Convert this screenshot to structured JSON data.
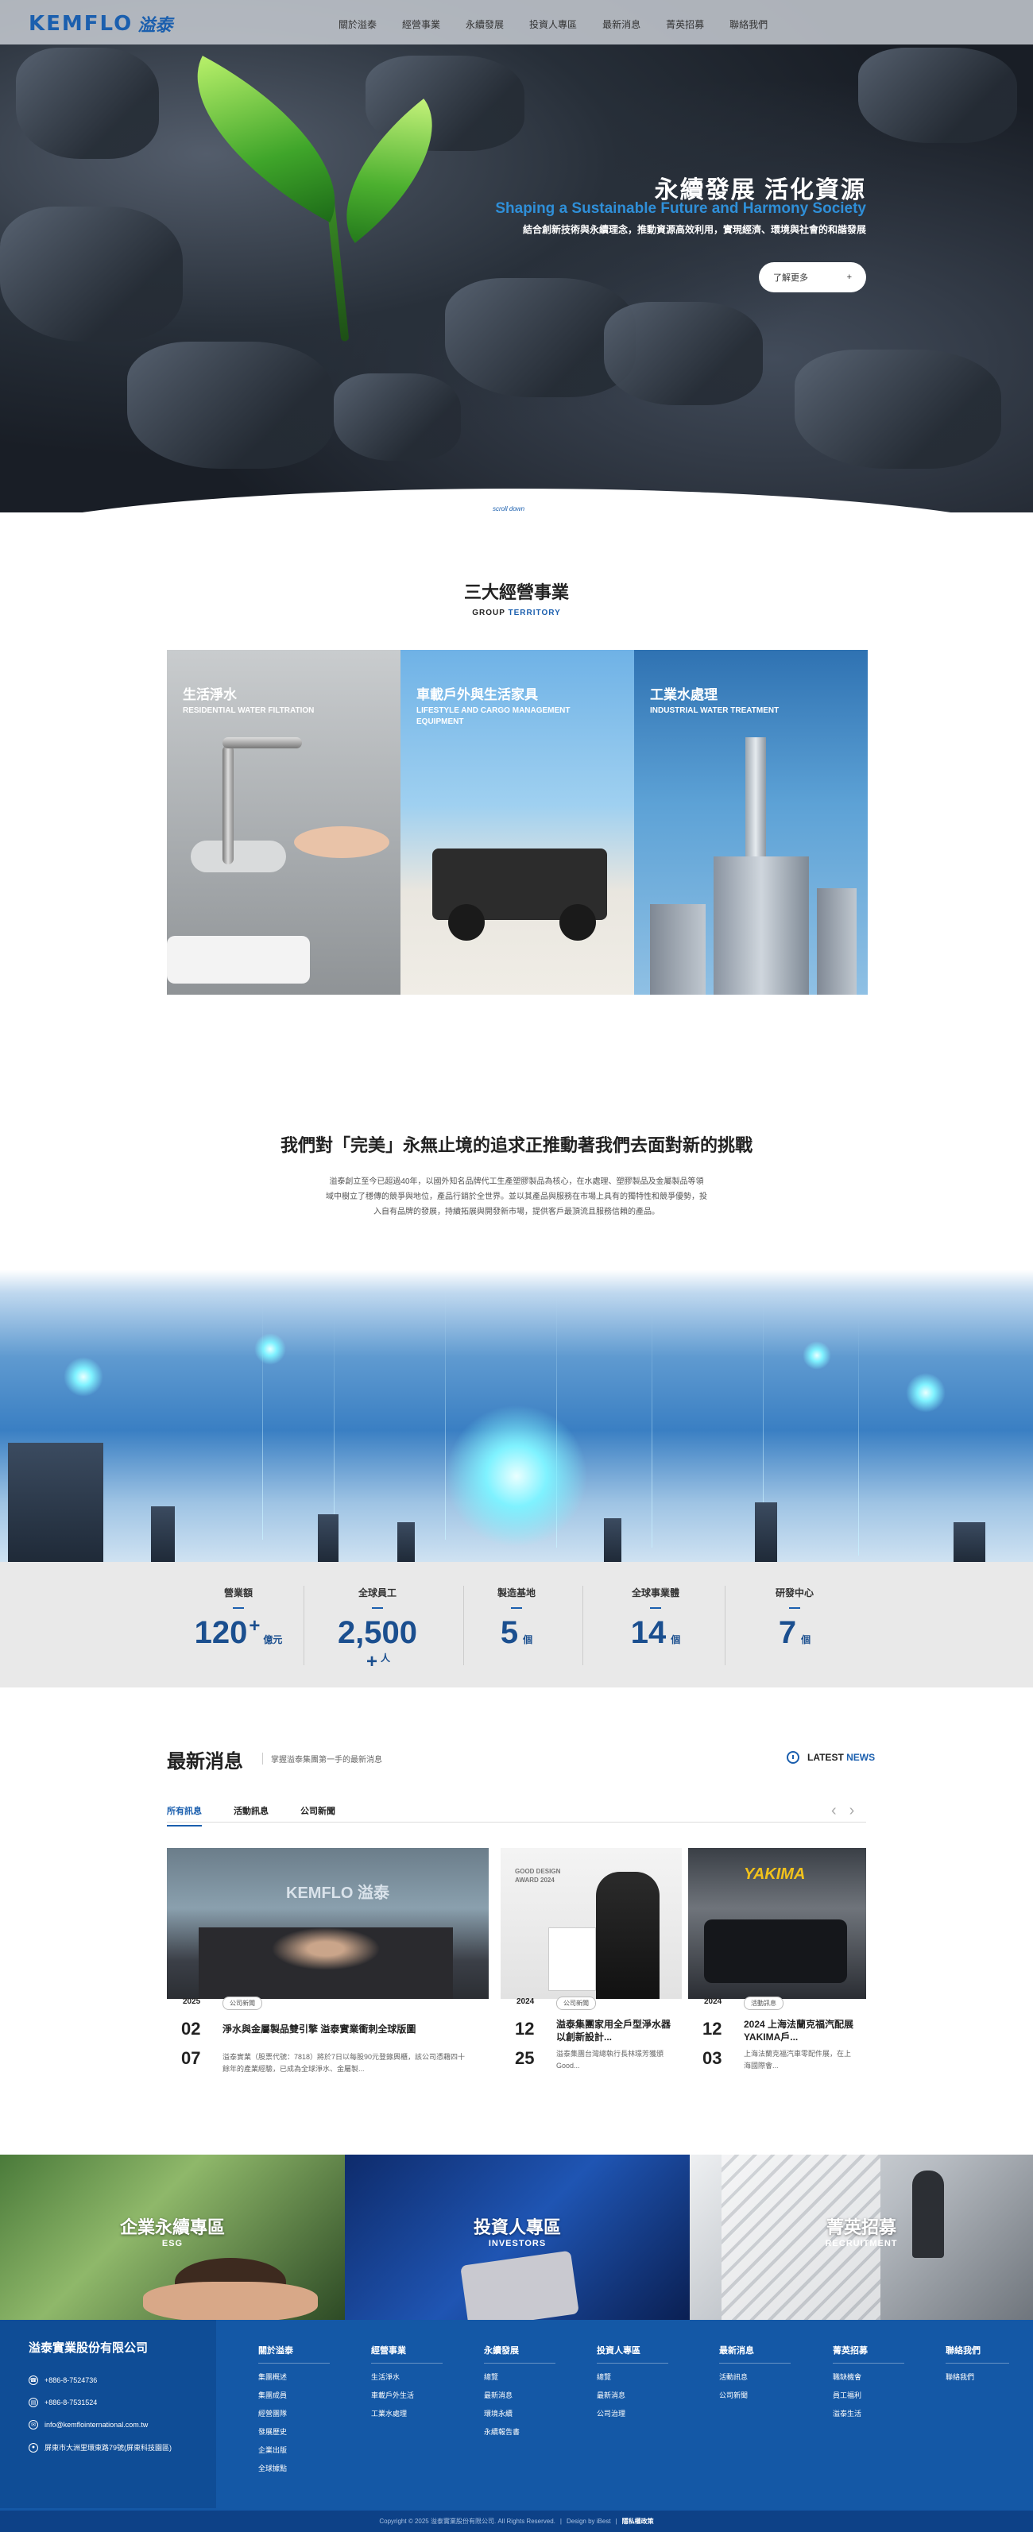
{
  "header": {
    "logo_text": "KEMFLO",
    "logo_cn": "溢泰",
    "nav": [
      "關於溢泰",
      "經營事業",
      "永續發展",
      "投資人專區",
      "最新消息",
      "菁英招募",
      "聯絡我們"
    ]
  },
  "hero": {
    "title": "永續發展 活化資源",
    "subtitle_en": "Shaping a Sustainable Future and Harmony Society",
    "desc": "結合創新技術與永續理念，推動資源高效利用，實現經濟、環境與社會的和諧發展",
    "button_label": "了解更多",
    "button_arrow": "+",
    "scroll_label": "scroll down"
  },
  "business": {
    "title": "三大經營事業",
    "subtitle_a": "GROUP",
    "subtitle_b": "TERRITORY",
    "items": [
      {
        "title": "生活淨水",
        "en": "RESIDENTIAL WATER FILTRATION"
      },
      {
        "title": "車載戶外與生活家具",
        "en": "LIFESTYLE AND CARGO MANAGEMENT EQUIPMENT"
      },
      {
        "title": "工業水處理",
        "en": "INDUSTRIAL WATER TREATMENT"
      }
    ]
  },
  "mission": {
    "title": "我們對「完美」永無止境的追求正推動著我們去面對新的挑戰",
    "text": "溢泰創立至今已超過40年，以國外知名品牌代工生產塑膠製品為核心，在水處理、塑膠製品及金屬製品等領域中樹立了穩傳的競爭與地位，產品行銷於全世界。並以其產品與服務在市場上具有的獨特性和競爭優勢，投入自有品牌的發展，持續拓展與開發新市場，提供客戶最頂流且服務信賴的產品。"
  },
  "stats": [
    {
      "label": "營業額",
      "value": "120",
      "plus": "+",
      "unit": "億元"
    },
    {
      "label": "全球員工",
      "value": "2,500",
      "plus": "+",
      "unit": "人"
    },
    {
      "label": "製造基地",
      "value": "5",
      "plus": "",
      "unit": "個"
    },
    {
      "label": "全球事業體",
      "value": "14",
      "plus": "",
      "unit": "個"
    },
    {
      "label": "研發中心",
      "value": "7",
      "plus": "",
      "unit": "個"
    }
  ],
  "news": {
    "title": "最新消息",
    "desc": "掌握溢泰集團第一手的最新消息",
    "latest_a": "LATEST",
    "latest_b": "NEWS",
    "tabs": [
      "所有訊息",
      "活動訊息",
      "公司新聞"
    ],
    "cards": [
      {
        "tag": "公司新聞",
        "year": "2025",
        "day": "02",
        "mon": "07",
        "head": "淨水與金屬製品雙引擎 溢泰實業衝刺全球版圖",
        "text": "溢泰實業（股票代號：7818）將於7日以每股90元登錄興櫃，該公司憑藉四十餘年的產業經驗，已成為全球淨水、金屬製..."
      },
      {
        "tag": "公司新聞",
        "year": "2024",
        "day": "12",
        "mon": "25",
        "head": "溢泰集團家用全戶型淨水器以創新設計...",
        "text": "溢泰集團台灣總執行長林璟芳獲頒Good..."
      },
      {
        "tag": "活動訊息",
        "year": "2024",
        "day": "12",
        "mon": "03",
        "head": "2024 上海法蘭克福汽配展 YAKIMA戶...",
        "text": "上海法蘭克福汽車零配件展，在上海國際會..."
      }
    ],
    "card_img_labels": [
      "KEMFLO 溢泰",
      "GOOD DESIGN AWARD 2024",
      "YAKIMA"
    ]
  },
  "banners": [
    {
      "cn": "企業永續專區",
      "en": "ESG"
    },
    {
      "cn": "投資人專區",
      "en": "INVESTORS"
    },
    {
      "cn": "菁英招募",
      "en": "RECRUITMENT"
    }
  ],
  "footer": {
    "company": "溢泰實業股份有限公司",
    "tel": "+886-8-7524736",
    "fax": "+886-8-7531524",
    "email": "info@kemflointernational.com.tw",
    "address": "屏東市大洲里環東路79號(屏東科技園區)",
    "columns": [
      {
        "title": "關於溢泰",
        "items": [
          "集團概述",
          "集團成員",
          "經營團隊",
          "發展歷史",
          "企業出版",
          "全球據點"
        ]
      },
      {
        "title": "經營事業",
        "items": [
          "生活淨水",
          "車載戶外生活",
          "工業水處理"
        ]
      },
      {
        "title": "永續發展",
        "items": [
          "總覽",
          "最新消息",
          "環境永續",
          "永續報告書"
        ]
      },
      {
        "title": "投資人專區",
        "items": [
          "總覽",
          "最新消息",
          "公司治理"
        ]
      },
      {
        "title": "最新消息",
        "items": [
          "活動訊息",
          "公司新聞"
        ]
      },
      {
        "title": "菁英招募",
        "items": [
          "職缺機會",
          "員工福利",
          "溢泰生活"
        ]
      },
      {
        "title": "聯絡我們",
        "items": [
          "聯絡我們"
        ]
      }
    ],
    "copyright": "Copyright © 2025 溢泰實業股份有限公司. All Rights Reserved.",
    "design": "Design by iBest",
    "privacy": "隱私權政策"
  },
  "colors": {
    "brand": "#1b5fae",
    "footer": "#1458a6",
    "stat_value": "#1b4f8f"
  }
}
